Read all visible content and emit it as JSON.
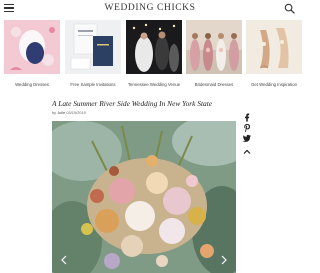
{
  "header": {
    "title": "WEDDING CHICKS",
    "menu_icon": "hamburger-icon",
    "search_icon": "search-icon"
  },
  "carousel": {
    "items": [
      {
        "label": "Wedding Dresses"
      },
      {
        "label": "Free Sample Invitations"
      },
      {
        "label": "Tennessee Wedding Venue"
      },
      {
        "label": "Bridesmaid Dresses"
      },
      {
        "label": "Get Wedding Inspiration"
      }
    ]
  },
  "post": {
    "title": "A Late Summer River Side Wedding In New York State",
    "by_prefix": "by",
    "author": "Julie",
    "date": "03/15/2019"
  },
  "share": {
    "icons": [
      "facebook-icon",
      "pinterest-icon",
      "twitter-icon",
      "chevron-up-icon"
    ]
  },
  "gallery": {
    "prev_icon": "chevron-left-icon",
    "next_icon": "chevron-right-icon"
  },
  "colors": {
    "text": "#222222",
    "muted": "#666666",
    "background": "#ffffff"
  }
}
